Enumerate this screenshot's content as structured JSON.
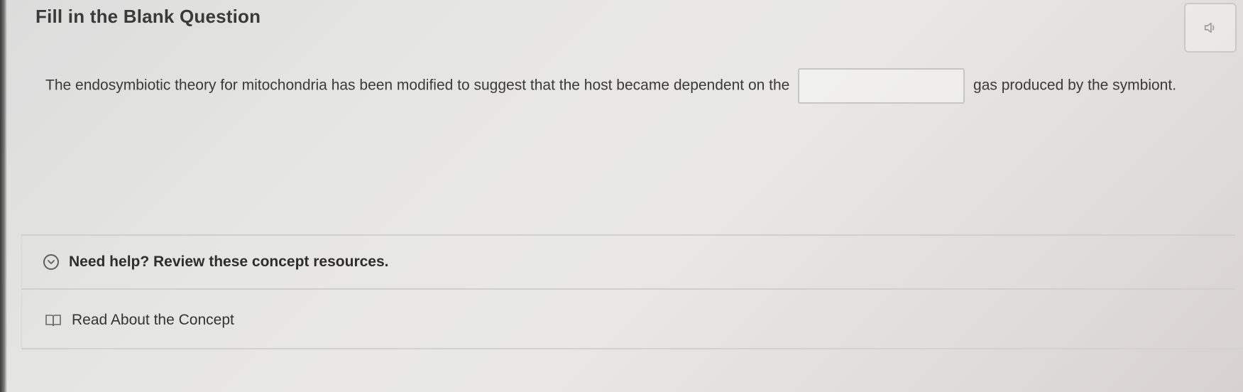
{
  "header": {
    "title": "Fill in the Blank Question",
    "audio_icon": "speaker-icon"
  },
  "question": {
    "text_before": "The endosymbiotic theory for mitochondria has been modified to suggest that the host became dependent on the",
    "blank_value": "",
    "text_after": "gas produced by the symbiont."
  },
  "help": {
    "toggle_icon": "chevron-down-icon",
    "label": "Need help? Review these concept resources."
  },
  "resources": [
    {
      "icon": "book-icon",
      "label": "Read About the Concept"
    }
  ]
}
